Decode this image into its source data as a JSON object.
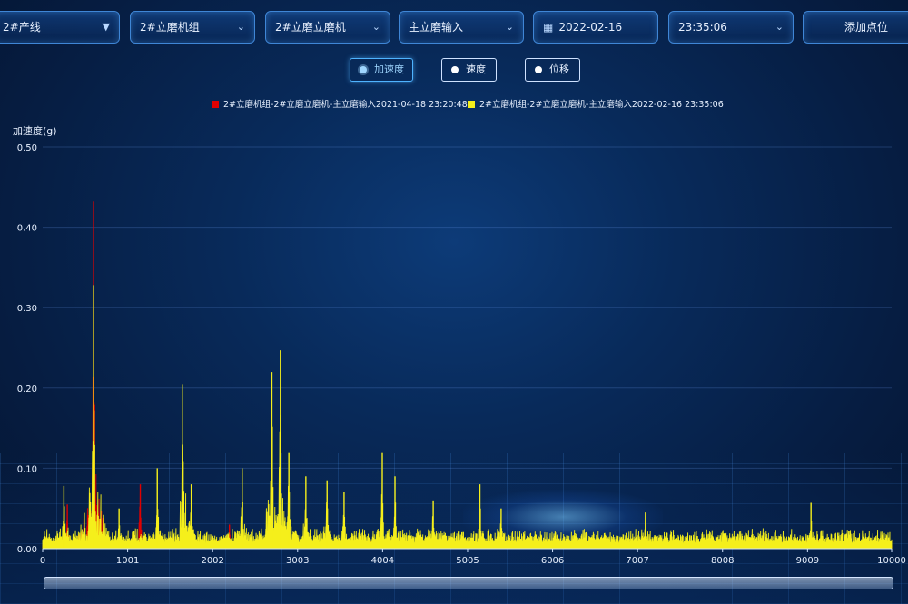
{
  "toolbar": {
    "line": "2#产线",
    "unit_group": "2#立磨机组",
    "machine": "2#立磨立磨机",
    "point": "主立磨输入",
    "date": "2022-02-16",
    "time": "23:35:06",
    "add_label": "添加点位"
  },
  "modes": {
    "accel": "加速度",
    "velocity": "速度",
    "displacement": "位移",
    "selected": "accel"
  },
  "colors": {
    "series1": "#e00000",
    "series2": "#f5ef1b",
    "axis": "#cfe2ff",
    "grid": "rgba(120,170,255,0.22)"
  },
  "chart_data": {
    "type": "line",
    "ylabel": "加速度(g)",
    "xlabel": "",
    "ylim": [
      0,
      0.5
    ],
    "yticks": [
      "0.00",
      "0.10",
      "0.20",
      "0.30",
      "0.40",
      "0.50"
    ],
    "xlim": [
      0,
      10000
    ],
    "xticks": [
      "0",
      "1001",
      "2002",
      "3003",
      "4004",
      "5005",
      "6006",
      "7007",
      "8008",
      "9009",
      "10000"
    ],
    "legend_position": "top-center",
    "series": [
      {
        "name": "2#立磨机组-2#立磨立磨机-主立磨输入2021-04-18 23:20:48",
        "color": "#e00000",
        "peaks": [
          [
            600,
            0.432
          ],
          [
            290,
            0.055
          ],
          [
            1150,
            0.08
          ],
          [
            2200,
            0.03
          ],
          [
            2800,
            0.06
          ],
          [
            4000,
            0.02
          ],
          [
            9050,
            0.015
          ]
        ],
        "baseline": 0.005
      },
      {
        "name": "2#立磨机组-2#立磨立磨机-主立磨输入2022-02-16 23:35:06",
        "color": "#f5ef1b",
        "peaks": [
          [
            600,
            0.328
          ],
          [
            250,
            0.078
          ],
          [
            900,
            0.05
          ],
          [
            1350,
            0.1
          ],
          [
            1650,
            0.205
          ],
          [
            1750,
            0.08
          ],
          [
            2350,
            0.1
          ],
          [
            2700,
            0.22
          ],
          [
            2800,
            0.247
          ],
          [
            2900,
            0.12
          ],
          [
            3100,
            0.09
          ],
          [
            3350,
            0.085
          ],
          [
            3550,
            0.07
          ],
          [
            4000,
            0.12
          ],
          [
            4150,
            0.09
          ],
          [
            4600,
            0.06
          ],
          [
            5150,
            0.08
          ],
          [
            5400,
            0.05
          ],
          [
            7100,
            0.045
          ],
          [
            9050,
            0.057
          ]
        ],
        "baseline": 0.012
      }
    ]
  }
}
